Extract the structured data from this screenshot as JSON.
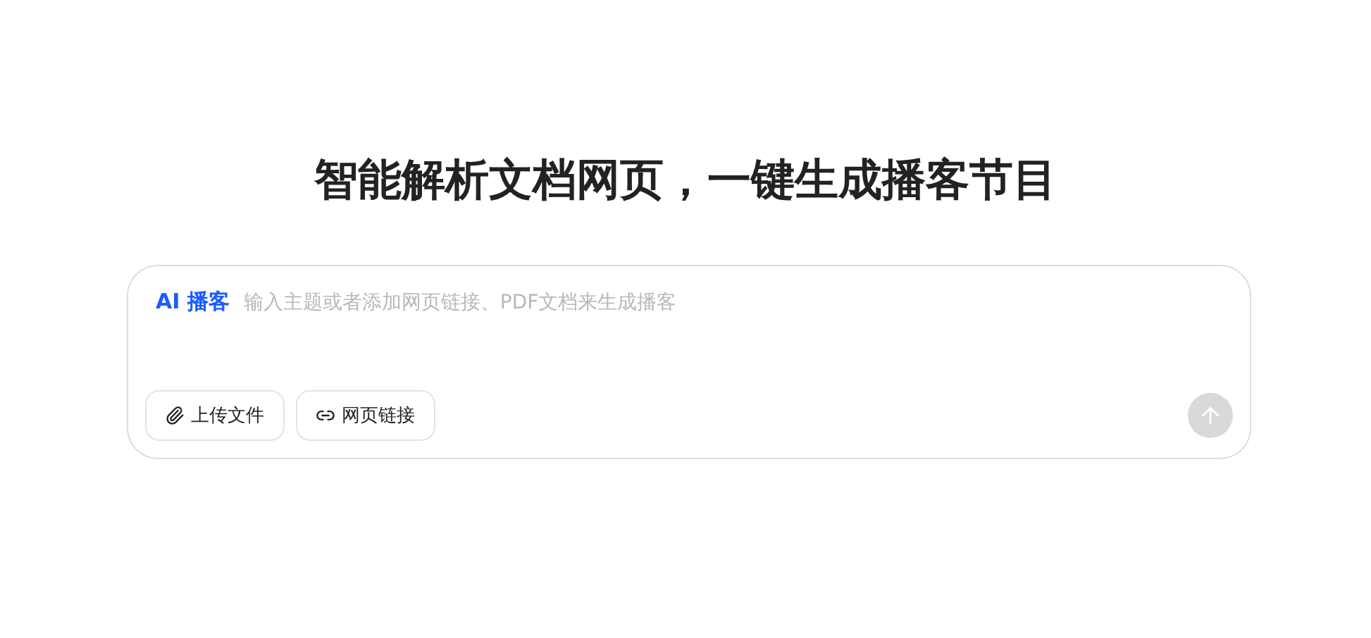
{
  "headline": "智能解析文档网页，一键生成播客节目",
  "composer": {
    "mode_label": "AI 播客",
    "placeholder": "输入主题或者添加网页链接、PDF文档来生成播客",
    "attachments": [
      {
        "kind": "file",
        "label": "上传文件"
      },
      {
        "kind": "link",
        "label": "网页链接"
      }
    ],
    "send": {
      "disabled": true
    }
  }
}
